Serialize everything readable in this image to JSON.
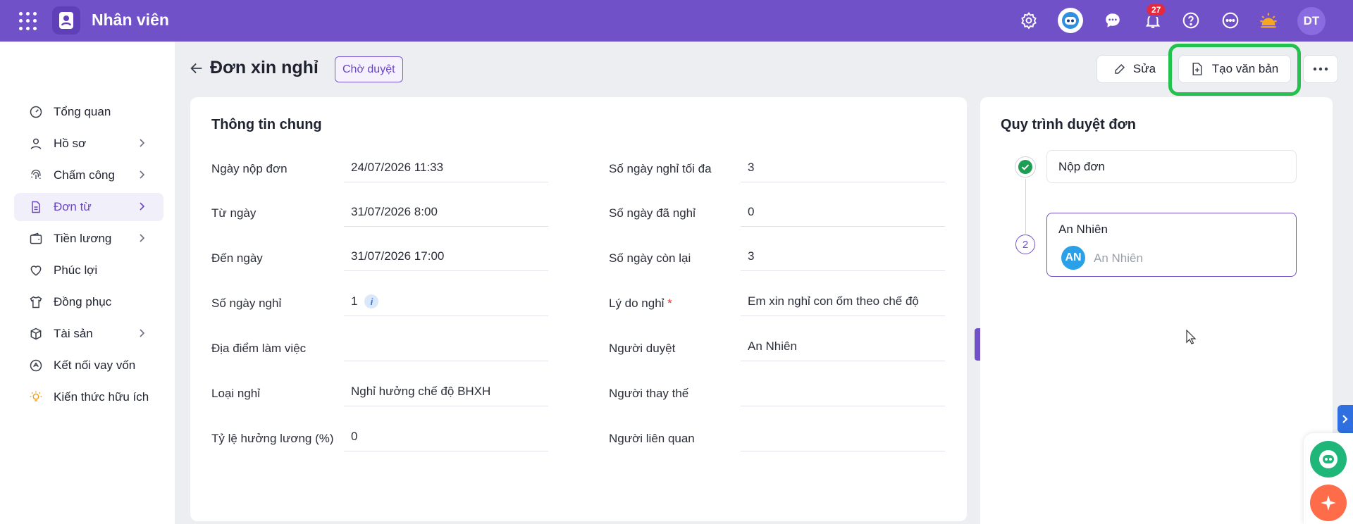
{
  "app": {
    "title": "Nhân viên",
    "user_initials": "DT",
    "notifications_count": "27"
  },
  "topbar": {
    "icons": [
      "settings-icon",
      "bot-icon",
      "chat-icon",
      "bell-icon",
      "help-icon",
      "more-circle-icon",
      "sun-icon"
    ]
  },
  "sidebar": {
    "items": [
      {
        "label": "Tổng quan",
        "icon": "dashboard-icon",
        "chevron": false
      },
      {
        "label": "Hồ sơ",
        "icon": "user-icon",
        "chevron": true
      },
      {
        "label": "Chấm công",
        "icon": "fingerprint-icon",
        "chevron": true
      },
      {
        "label": "Đơn từ",
        "icon": "document-icon",
        "chevron": true,
        "active": true
      },
      {
        "label": "Tiền lương",
        "icon": "wallet-icon",
        "chevron": true
      },
      {
        "label": "Phúc lợi",
        "icon": "heart-icon",
        "chevron": false
      },
      {
        "label": "Đồng phục",
        "icon": "shirt-icon",
        "chevron": false
      },
      {
        "label": "Tài sản",
        "icon": "box-icon",
        "chevron": true
      },
      {
        "label": "Kết nối vay vốn",
        "icon": "coins-icon",
        "chevron": false
      },
      {
        "label": "Kiến thức hữu ích",
        "icon": "bulb-icon",
        "chevron": false
      }
    ]
  },
  "header": {
    "title": "Đơn xin nghỉ",
    "status": "Chờ duyệt",
    "edit_label": "Sửa",
    "create_doc_label": "Tạo văn bản"
  },
  "info": {
    "section_title": "Thông tin chung",
    "left": [
      {
        "label": "Ngày nộp đơn",
        "value": "24/07/2026 11:33"
      },
      {
        "label": "Từ ngày",
        "value": "31/07/2026 8:00"
      },
      {
        "label": "Đến ngày",
        "value": "31/07/2026 17:00"
      },
      {
        "label": "Số ngày nghỉ",
        "value": "1"
      },
      {
        "label": "Địa điểm làm việc",
        "value": ""
      },
      {
        "label": "Loại nghỉ",
        "value": "Nghỉ hưởng chế độ BHXH"
      },
      {
        "label": "Tỷ lệ hưởng lương (%)",
        "value": "0"
      }
    ],
    "right": [
      {
        "label": "Số ngày nghỉ tối đa",
        "value": "3"
      },
      {
        "label": "Số ngày đã nghỉ",
        "value": "0"
      },
      {
        "label": "Số ngày còn lại",
        "value": "3"
      },
      {
        "label": "Lý do nghỉ",
        "value": "Em xin nghỉ con ốm theo chế độ",
        "required": true
      },
      {
        "label": "Người duyệt",
        "value": "An Nhiên"
      },
      {
        "label": "Người thay thế",
        "value": ""
      },
      {
        "label": "Người liên quan",
        "value": ""
      }
    ]
  },
  "workflow": {
    "title": "Quy trình duyệt đơn",
    "steps": [
      {
        "label": "Nộp đơn",
        "status": "done"
      },
      {
        "number": "2",
        "label": "An Nhiên",
        "approver_initials": "AN",
        "approver_name": "An Nhiên"
      }
    ]
  },
  "colors": {
    "primary": "#7151c7",
    "highlight": "#23c24f",
    "danger": "#e5283c"
  }
}
